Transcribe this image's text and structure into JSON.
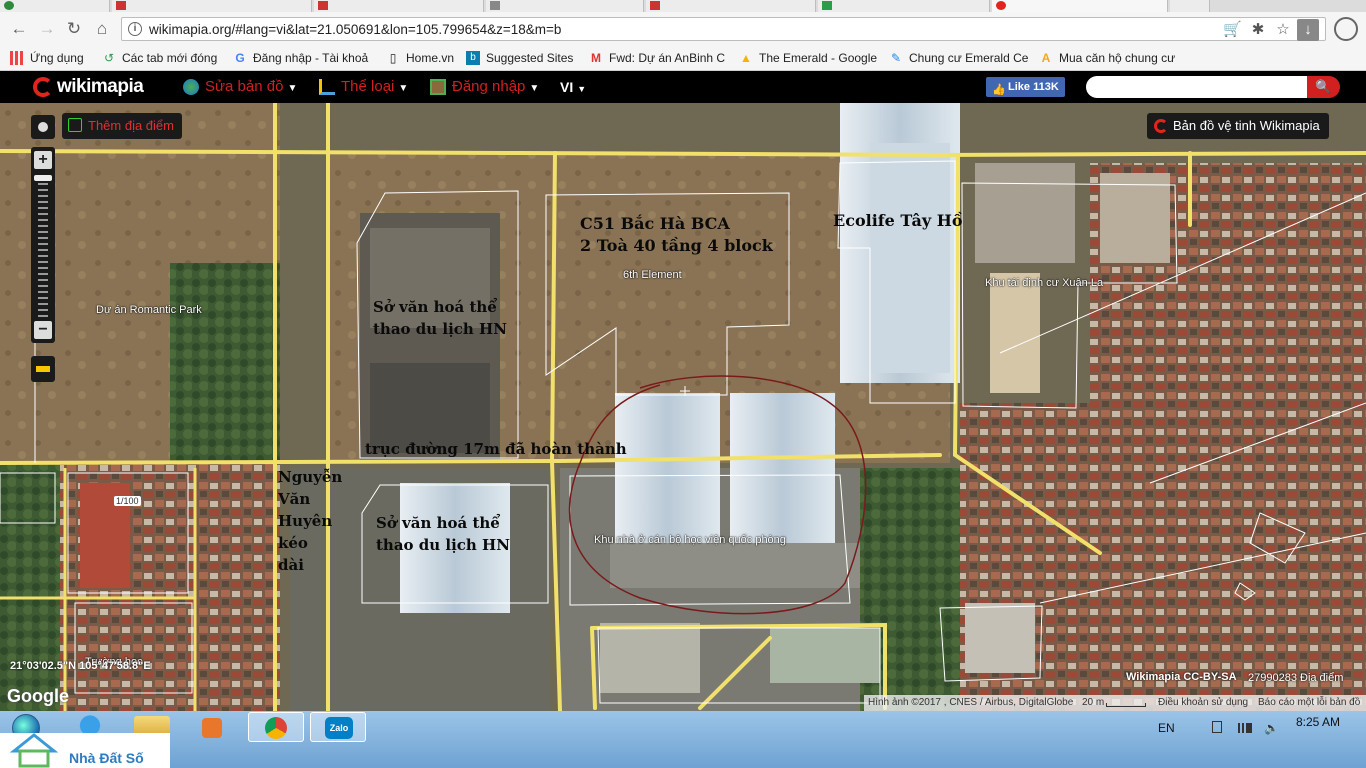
{
  "browser": {
    "url": "wikimapia.org/#lang=vi&lat=21.050691&lon=105.799654&z=18&m=b",
    "bookmarks": [
      {
        "label": "Ứng dụng",
        "icon": "apps-grid-icon"
      },
      {
        "label": "Các tab mới đóng",
        "icon": "history-icon"
      },
      {
        "label": "Đăng nhập - Tài khoả",
        "icon": "google-icon"
      },
      {
        "label": "Home.vn",
        "icon": "page-icon"
      },
      {
        "label": "Suggested Sites",
        "icon": "bing-icon"
      },
      {
        "label": "Fwd: Dự án AnBinh C",
        "icon": "gmail-icon"
      },
      {
        "label": "The Emerald - Google",
        "icon": "drive-icon"
      },
      {
        "label": "Chung cư Emerald Ce",
        "icon": "page-edit-icon"
      },
      {
        "label": "Mua căn hộ chung cư",
        "icon": "site-icon"
      }
    ]
  },
  "wikimapia": {
    "logo": "wikimapia",
    "menu": [
      {
        "label": "Sửa bản đồ"
      },
      {
        "label": "Thể loại"
      },
      {
        "label": "Đăng nhập"
      }
    ],
    "lang": "VI",
    "fb_like": "Like 113K",
    "add_place": "Thêm địa điểm",
    "satellite_button": "Bản đồ vệ tinh Wikimapia"
  },
  "map": {
    "place_labels": {
      "romantic_park": "Dự án Romantic Park",
      "sixth_element": "6th Element",
      "khu_tai_dinh_cu": "Khu tái định cư Xuân La",
      "khu_nha_o": "Khu nhà ở cán bộ học viện quốc phòng",
      "truong_hoc": "Trường học",
      "icon_1100": "1/100"
    },
    "annotations": {
      "c51_line1": "C51 Bắc Hà BCA",
      "c51_line2": "2 Toà 40 tầng 4 block",
      "ecolife": "Ecolife Tây Hồ",
      "svh1_line1": "Sở văn hoá thể",
      "svh1_line2": "thao du lịch HN",
      "truc_duong": "trục đường 17m đã hoàn thành",
      "svh2_line1": "Sở văn hoá thể",
      "svh2_line2": "thao du lịch HN",
      "nvh_1": "Nguyễn",
      "nvh_2": "Văn",
      "nvh_3": "Huyên",
      "nvh_4": "kéo",
      "nvh_5": "dài"
    },
    "coords": "21°03'02.5\"N 105°47'58.8\"E",
    "google": "Google",
    "license": "Wikimapia CC-BY-SA",
    "place_count": "27990283 Địa điểm",
    "attribution": {
      "imagery": "Hình ảnh ©2017 , CNES / Airbus, DigitalGlobe",
      "scale": "20 m",
      "terms": "Điều khoản sử dụng",
      "report": "Báo cáo một lỗi bản đồ"
    }
  },
  "taskbar": {
    "lang": "EN",
    "clock": "8:25 AM",
    "zalo": "Zalo"
  },
  "watermark": "Nhà Đất Số"
}
